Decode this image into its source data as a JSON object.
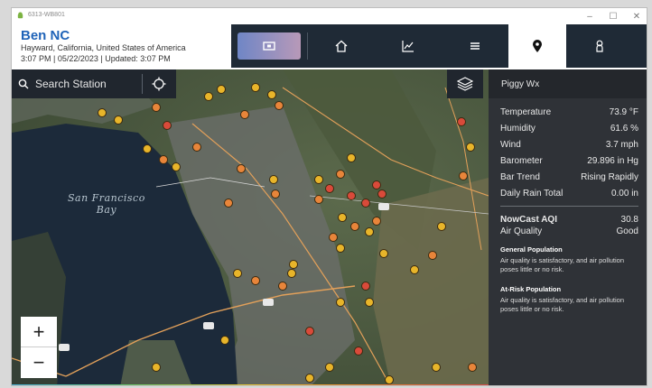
{
  "window": {
    "title": "6313-WB801"
  },
  "header": {
    "station_name": "Ben NC",
    "location": "Hayward, California, United States of America",
    "time_line": "3:07 PM | 05/22/2023 | Updated: 3:07 PM"
  },
  "nav": {
    "items": [
      {
        "name": "map",
        "icon": "map-icon"
      },
      {
        "name": "home",
        "icon": "home-icon"
      },
      {
        "name": "charts",
        "icon": "chart-icon"
      },
      {
        "name": "list",
        "icon": "list-icon"
      },
      {
        "name": "location",
        "icon": "location-pin-icon",
        "active": true
      },
      {
        "name": "account",
        "icon": "person-icon"
      }
    ]
  },
  "map": {
    "search_placeholder": "Search Station",
    "labels": {
      "bay": "San Francisco\nBay"
    },
    "zoom_in": "+",
    "zoom_out": "−"
  },
  "panel": {
    "title": "Piggy Wx",
    "rows": [
      {
        "label": "Temperature",
        "value": "73.9 °F"
      },
      {
        "label": "Humidity",
        "value": "61.6 %"
      },
      {
        "label": "Wind",
        "value": "3.7 mph"
      },
      {
        "label": "Barometer",
        "value": "29.896 in Hg"
      },
      {
        "label": "Bar Trend",
        "value": "Rising Rapidly"
      },
      {
        "label": "Daily Rain Total",
        "value": "0.00 in"
      }
    ],
    "aqi": {
      "label": "NowCast AQI",
      "value": "30.8",
      "quality_label": "Air Quality",
      "quality_value": "Good"
    },
    "general": {
      "title": "General Population",
      "text": "Air quality is satisfactory, and air pollution poses little or no risk."
    },
    "at_risk": {
      "title": "At-Risk Population",
      "text": "Air quality is satisfactory, and air pollution poses little or no risk."
    }
  },
  "colors": {
    "accent_blue": "#1f63b8",
    "nav_bg": "#1f2a36",
    "panel_bg": "#2f3237",
    "marker_yellow": "#e8b52a",
    "marker_orange": "#e8853a",
    "marker_red": "#d94a3a"
  }
}
